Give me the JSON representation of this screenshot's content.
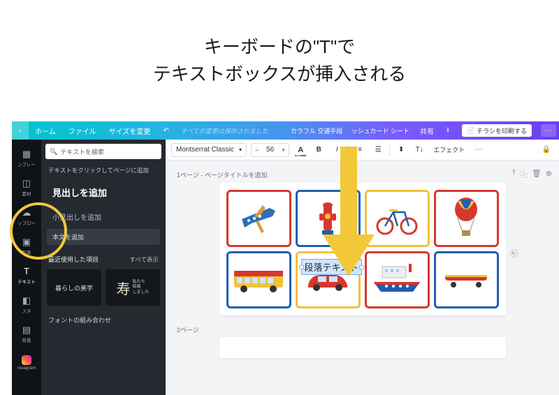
{
  "instruction": {
    "line1": "キーボードの\"T\"で",
    "line2": "テキストボックスが挿入される"
  },
  "topbar": {
    "home": "ホーム",
    "file": "ファイル",
    "resize": "サイズを変更",
    "save_note": "すべての変更は保存されました",
    "doc_title": "カラフル 交通手段",
    "doc_suffix": "ッシュカード シート",
    "share": "共有",
    "print": "チラシを印刷する"
  },
  "rail": {
    "templates": "ンプレー",
    "elements": "素材",
    "uploads": "ップロー",
    "photos": "写真",
    "text": "テキスト",
    "styles": "スタ",
    "bg": "背景",
    "instagram": "nstagram"
  },
  "panel": {
    "search_placeholder": "テキストを検索",
    "hint": "テキストをクリックしてページに追加",
    "heading": "見出しを追加",
    "subheading": "小見出しを追加",
    "body": "本文を追加",
    "recent": "最近使用した項目",
    "view_all": "すべて表示",
    "tmpl1": "暮らしの美学",
    "tmpl2_big": "寿",
    "tmpl2_small": "私たち\n結婚\nしました",
    "combos": "フォントの組み合わせ"
  },
  "fmt": {
    "font": "Montserrat Classic",
    "size": "56",
    "effects": "エフェクト"
  },
  "pages": {
    "p1_label": "1ページ - ページタイトルを追加",
    "p2_label": "2ページ",
    "inserted": "段落テキスト"
  }
}
